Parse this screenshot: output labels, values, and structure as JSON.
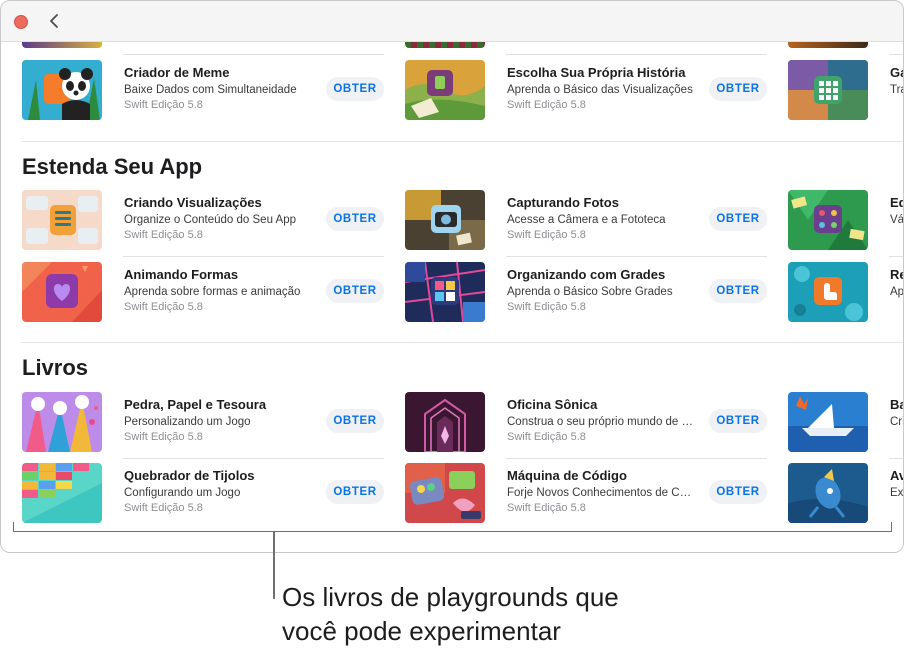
{
  "toolbar": {
    "back_icon": "chevron-left-icon",
    "close_color": "#ed6a5e"
  },
  "sections": {
    "top": {
      "items": [
        {
          "title": "Criador de Meme",
          "subtitle": "Baixe Dados com Simultaneidade",
          "meta": "Swift Edição 5.8",
          "button": "OBTER"
        },
        {
          "title": "Escolha Sua Própria História",
          "subtitle": "Aprenda o Básico das Visualizações",
          "meta": "Swift Edição 5.8",
          "button": "OBTER"
        },
        {
          "title": "Ga",
          "subtitle": "Tra"
        }
      ]
    },
    "extend": {
      "title": "Estenda Seu App",
      "items": [
        {
          "title": "Criando Visualizações",
          "subtitle": "Organize o Conteúdo do Seu App",
          "meta": "Swift Edição 5.8",
          "button": "OBTER"
        },
        {
          "title": "Capturando Fotos",
          "subtitle": "Acesse a Câmera e a Fototeca",
          "meta": "Swift Edição 5.8",
          "button": "OBTER"
        },
        {
          "title": "Ed",
          "subtitle": "Vá"
        },
        {
          "title": "Animando Formas",
          "subtitle": "Aprenda sobre formas e animação",
          "meta": "Swift Edição 5.8",
          "button": "OBTER"
        },
        {
          "title": "Organizando com Grades",
          "subtitle": "Aprenda o Básico Sobre Grades",
          "meta": "Swift Edição 5.8",
          "button": "OBTER"
        },
        {
          "title": "Re",
          "subtitle": "Ap"
        }
      ]
    },
    "books": {
      "title": "Livros",
      "items": [
        {
          "title": "Pedra, Papel e Tesoura",
          "subtitle": "Personalizando um Jogo",
          "meta": "Swift Edição 5.8",
          "button": "OBTER"
        },
        {
          "title": "Oficina Sônica",
          "subtitle": "Construa o seu próprio mundo de sons",
          "meta": "Swift Edição 5.8",
          "button": "OBTER"
        },
        {
          "title": "Ba",
          "subtitle": "Cri"
        },
        {
          "title": "Quebrador de Tijolos",
          "subtitle": "Configurando um Jogo",
          "meta": "Swift Edição 5.8",
          "button": "OBTER"
        },
        {
          "title": "Máquina de Código",
          "subtitle": "Forje Novos Conhecimentos de Código",
          "meta": "Swift Edição 5.8",
          "button": "OBTER"
        },
        {
          "title": "Av",
          "subtitle": "Exp"
        }
      ]
    }
  },
  "callout": {
    "line1": "Os livros de playgrounds que",
    "line2": "você pode experimentar"
  }
}
